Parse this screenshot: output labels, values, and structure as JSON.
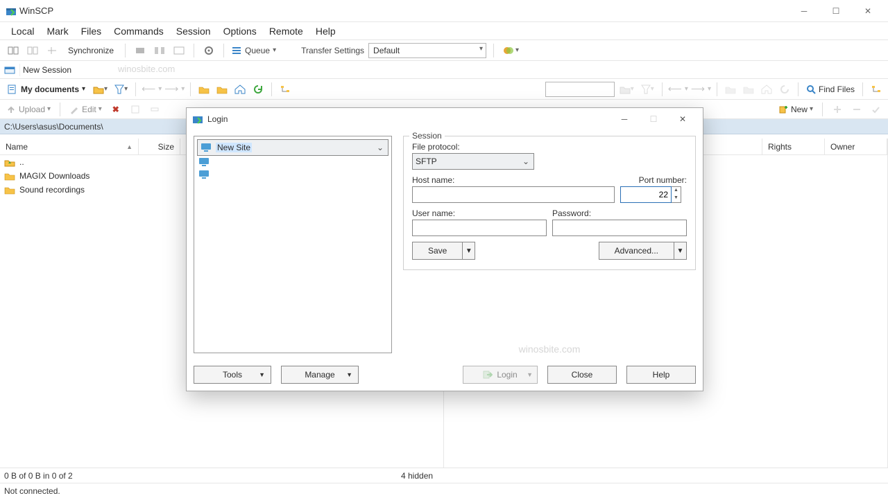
{
  "title": "WinSCP",
  "menus": [
    "Local",
    "Mark",
    "Files",
    "Commands",
    "Session",
    "Options",
    "Remote",
    "Help"
  ],
  "toolbar": {
    "synchronize": "Synchronize",
    "queue": "Queue",
    "transfer_settings_label": "Transfer Settings",
    "transfer_settings_value": "Default"
  },
  "tabs": {
    "new_session": "New Session"
  },
  "nav": {
    "local_drive": "My documents",
    "find_files": "Find Files"
  },
  "actions": {
    "upload": "Upload",
    "edit": "Edit",
    "new": "New"
  },
  "paths": {
    "local": "C:\\Users\\asus\\Documents\\"
  },
  "columns_local": {
    "name": "Name",
    "size": "Size"
  },
  "columns_remote": {
    "rights": "Rights",
    "owner": "Owner"
  },
  "files": [
    {
      "name": "..",
      "type": "up"
    },
    {
      "name": "MAGIX Downloads",
      "type": "folder"
    },
    {
      "name": "Sound recordings",
      "type": "folder"
    }
  ],
  "status": {
    "selection": "0 B of 0 B in 0 of 2",
    "hidden": "4 hidden",
    "connection": "Not connected."
  },
  "watermark": "winosbite.com",
  "dialog": {
    "title": "Login",
    "tree": {
      "new_site": "New Site"
    },
    "session_legend": "Session",
    "file_protocol_label": "File protocol:",
    "file_protocol_value": "SFTP",
    "host_label": "Host name:",
    "port_label": "Port number:",
    "port_value": "22",
    "user_label": "User name:",
    "password_label": "Password:",
    "save": "Save",
    "advanced": "Advanced...",
    "tools": "Tools",
    "manage": "Manage",
    "login": "Login",
    "close": "Close",
    "help": "Help"
  }
}
